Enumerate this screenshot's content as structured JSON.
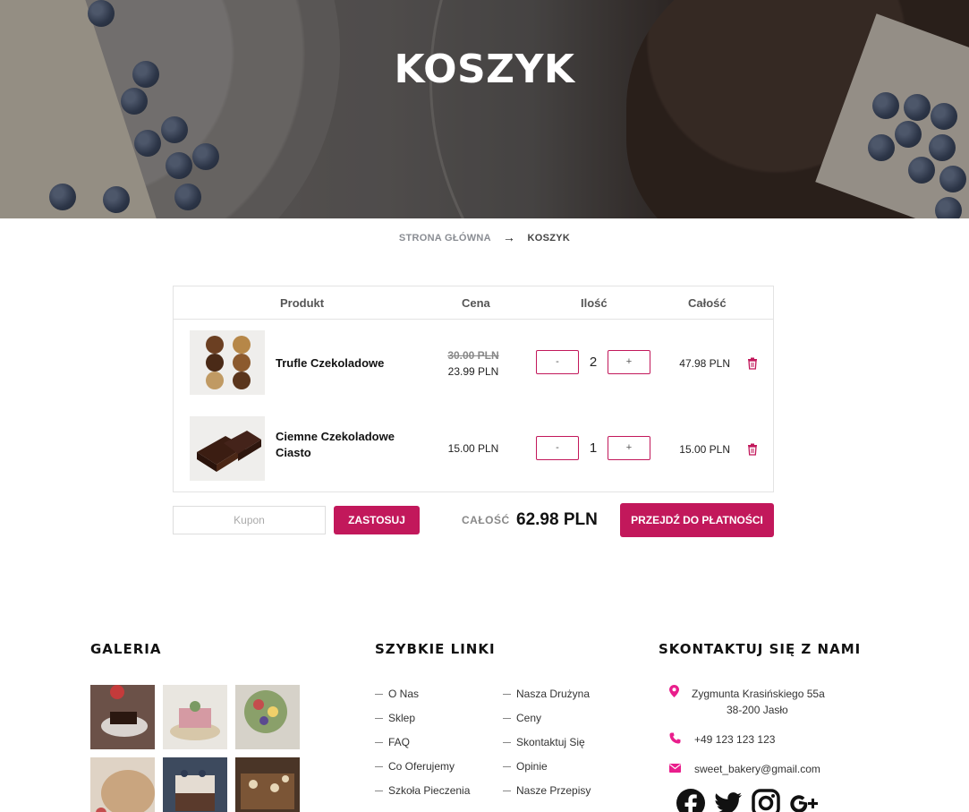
{
  "hero": {
    "title": "KOSZYK"
  },
  "breadcrumb": {
    "home": "STRONA GŁÓWNA",
    "current": "KOSZYK"
  },
  "cart": {
    "headers": {
      "product": "Produkt",
      "price": "Cena",
      "quantity": "Ilość",
      "total": "Całość"
    },
    "items": [
      {
        "name": "Trufle Czekoladowe",
        "old_price": "30.00 PLN",
        "price": "23.99 PLN",
        "quantity": "2",
        "total": "47.98 PLN",
        "minus": "-",
        "plus": "+"
      },
      {
        "name": "Ciemne Czekoladowe Ciasto",
        "price": "15.00 PLN",
        "quantity": "1",
        "total": "15.00 PLN",
        "minus": "-",
        "plus": "+"
      }
    ]
  },
  "coupon": {
    "placeholder": "Kupon",
    "apply_label": "ZASTOSUJ"
  },
  "summary": {
    "label": "CAŁOŚĆ",
    "value": "62.98 PLN",
    "checkout_label": "PRZEJDŹ DO PŁATNOŚCI"
  },
  "footer": {
    "gallery_title": "GALERIA",
    "links_title": "SZYBKIE LINKI",
    "links_left": [
      "O Nas",
      "Sklep",
      "FAQ",
      "Co Oferujemy",
      "Szkoła Pieczenia"
    ],
    "links_right": [
      "Nasza Drużyna",
      "Ceny",
      "Skontaktuj Się",
      "Opinie",
      "Nasze Przepisy"
    ],
    "contact_title": "SKONTAKTUJ SIĘ Z NAMI",
    "address_line1": "Zygmunta Krasińskiego 55a",
    "address_line2": "38-200 Jasło",
    "phone": "+49 123 123 123",
    "email": "sweet_bakery@gmail.com",
    "social": [
      "facebook-icon",
      "twitter-icon",
      "instagram-icon",
      "google-plus-icon"
    ]
  },
  "colors": {
    "accent": "#c2185b",
    "icon_pink": "#e91e8c"
  }
}
